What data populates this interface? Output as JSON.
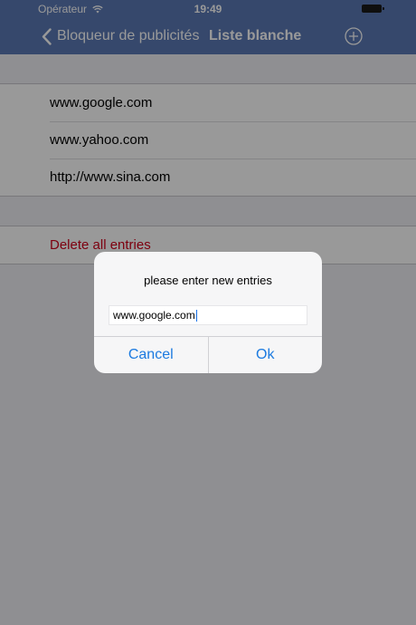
{
  "status_bar": {
    "carrier": "Opérateur",
    "time": "19:49"
  },
  "nav": {
    "back_label": "Bloqueur de publicités",
    "title": "Liste blanche",
    "add_icon": "plus-circle-icon",
    "back_icon": "chevron-left-icon"
  },
  "whitelist": {
    "entries": [
      "www.google.com",
      "www.yahoo.com",
      "http://www.sina.com"
    ]
  },
  "actions": {
    "delete_all_label": "Delete all entries"
  },
  "alert": {
    "message": "please enter new entries",
    "input_value": "www.google.com",
    "cancel_label": "Cancel",
    "ok_label": "Ok"
  },
  "colors": {
    "nav_bar": "#5b79b4",
    "destructive": "#d0021b",
    "alert_button": "#1b7ae0",
    "background": "#efeff4"
  }
}
